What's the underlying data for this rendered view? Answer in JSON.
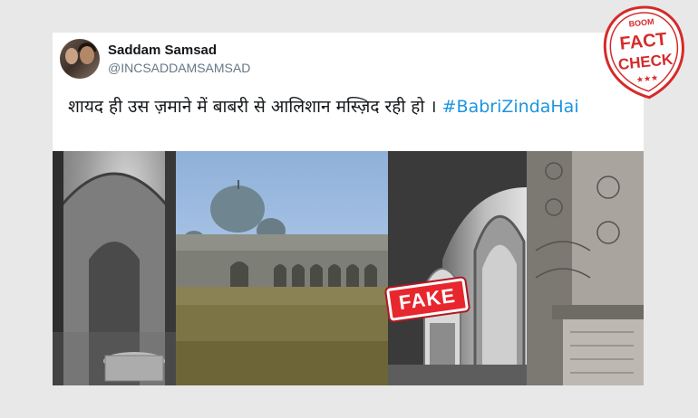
{
  "tweet": {
    "display_name": "Saddam Samsad",
    "handle": "@INCSADDAMSAMSAD",
    "menu_icon": "chevron-down-icon",
    "text": "शायद ही उस ज़माने में बाबरी से आलिशान मस्ज़िद रही हो । ",
    "hashtag": "#BabriZindaHai"
  },
  "overlay": {
    "fake_label": "FAKE"
  },
  "fact_check_badge": {
    "brand": "BOOM",
    "line1": "FACT",
    "line2": "CHECK",
    "stars": "★★★"
  },
  "colors": {
    "hashtag": "#1b95e0",
    "stamp_red": "#e8262e"
  }
}
